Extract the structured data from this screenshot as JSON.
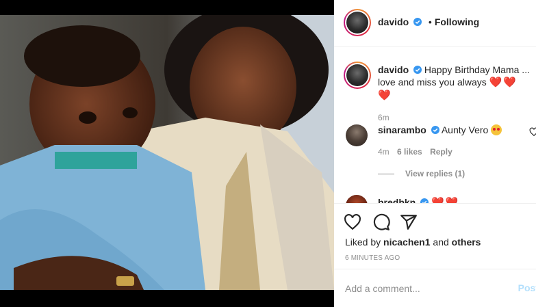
{
  "post": {
    "username": "davido",
    "follow_status": "Following"
  },
  "caption": {
    "username": "davido",
    "text_line1": "Happy Birthday Mama ...",
    "text_line2": "love and miss you always",
    "hearts": "❤️❤️❤️",
    "time": "6m"
  },
  "comments": [
    {
      "username": "sinarambo",
      "text": "Aunty Vero",
      "time": "4m",
      "likes": "6 likes",
      "reply_label": "Reply",
      "view_replies": "View replies (1)"
    },
    {
      "username": "bredbkn"
    }
  ],
  "footer": {
    "liked_by_prefix": "Liked by",
    "liked_by_user": "nicachen1",
    "liked_by_and": "and",
    "liked_by_others": "others",
    "time_ago": "6 MINUTES AGO",
    "comment_placeholder": "Add a comment...",
    "post_label": "Post"
  },
  "icons": [
    "heart-icon",
    "comment-icon",
    "share-icon",
    "verified-icon",
    "like-comment-icon"
  ],
  "colors": {
    "verified_blue": "#3897f0",
    "heart_red": "#e0202a",
    "muted_text": "#8e8e8e",
    "post_button": "#b2dffc"
  }
}
